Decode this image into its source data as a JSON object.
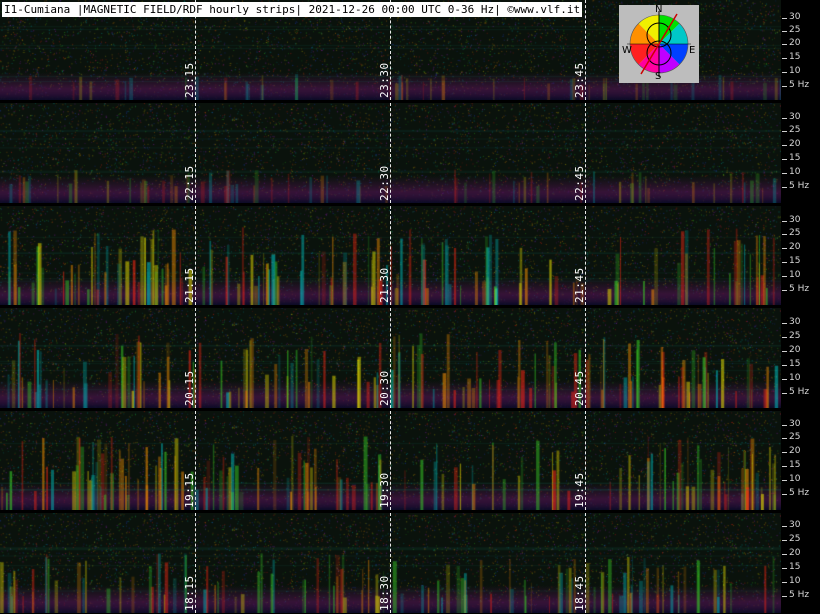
{
  "title": "I1-Cumiana |MAGNETIC FIELD/RDF hourly strips| 2021-12-26 00:00 UTC 0-36 Hz| ©www.vlf.it",
  "compass": {
    "north": "N",
    "south": "S",
    "east": "E",
    "west": "W"
  },
  "scale_labels": [
    "30",
    "25",
    "20",
    "15",
    "10",
    "5 Hz"
  ],
  "strips": [
    {
      "name": "strip-23h",
      "time_labels": [
        "23:15",
        "23:30",
        "23:45"
      ],
      "activity": 0.15
    },
    {
      "name": "strip-22h",
      "time_labels": [
        "22:15",
        "22:30",
        "22:45"
      ],
      "activity": 0.25
    },
    {
      "name": "strip-21h",
      "time_labels": [
        "21:15",
        "21:30",
        "21:45"
      ],
      "activity": 0.85
    },
    {
      "name": "strip-20h",
      "time_labels": [
        "20:15",
        "20:30",
        "20:45"
      ],
      "activity": 0.8
    },
    {
      "name": "strip-19h",
      "time_labels": [
        "19:15",
        "19:30",
        "19:45"
      ],
      "activity": 0.8
    },
    {
      "name": "strip-18h",
      "time_labels": [
        "18:15",
        "18:30",
        "18:45"
      ],
      "activity": 0.6
    }
  ]
}
